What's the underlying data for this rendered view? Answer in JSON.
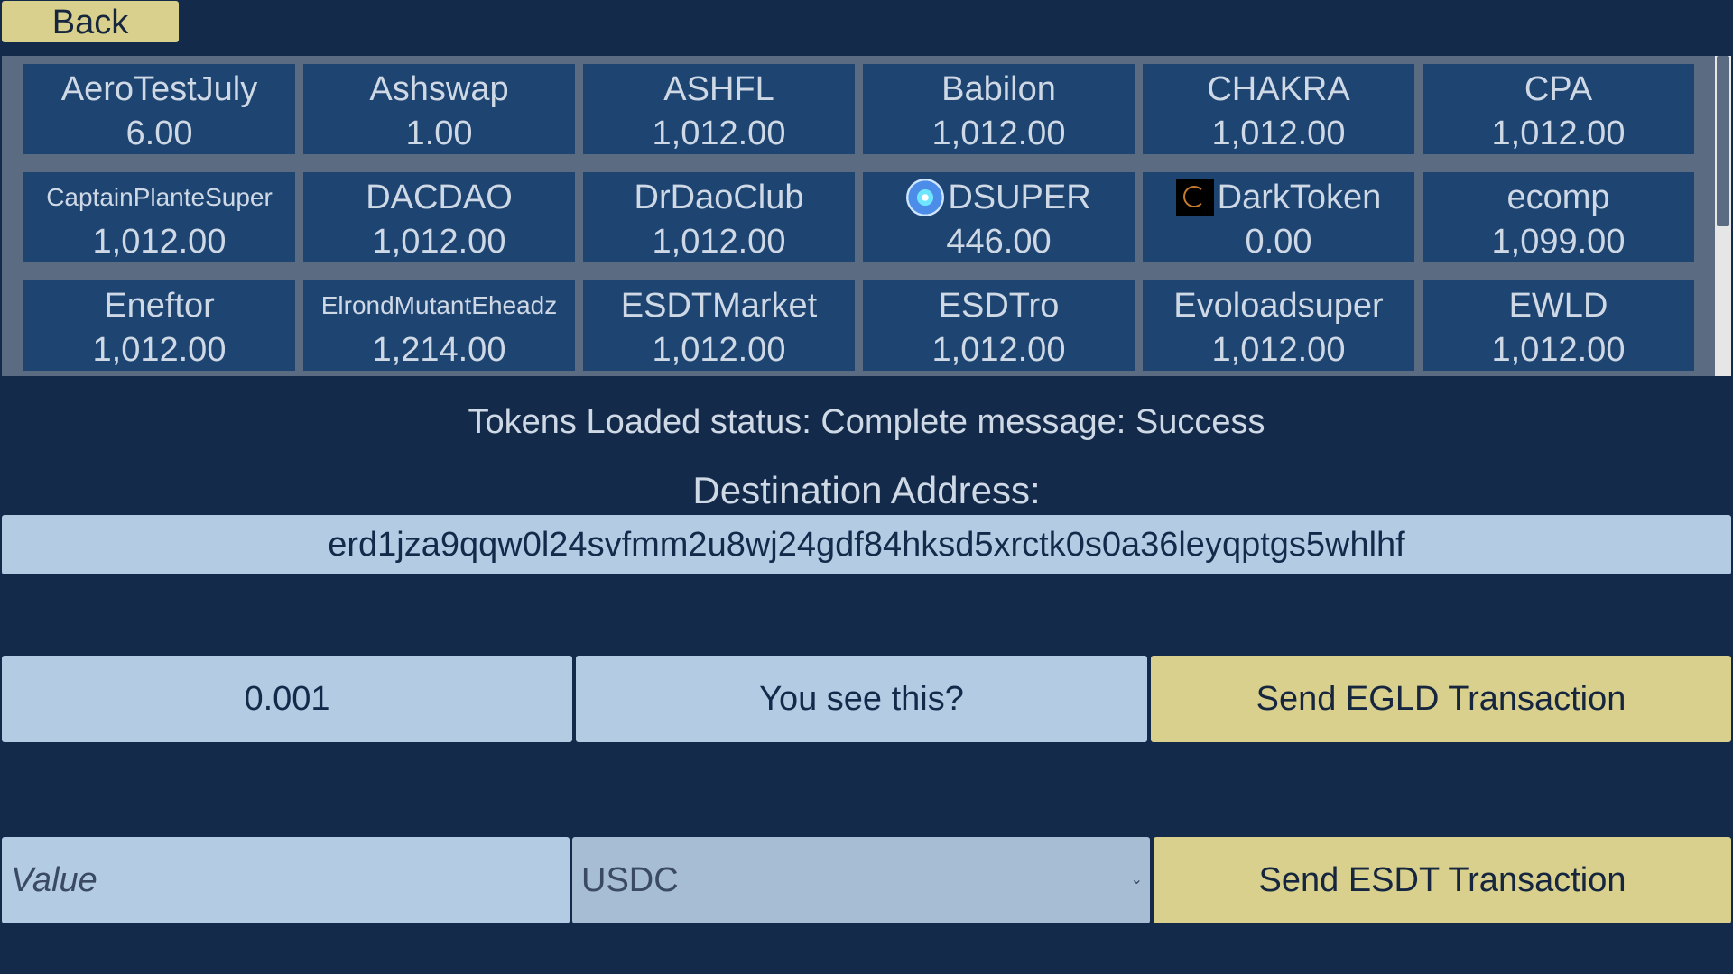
{
  "back_label": "Back",
  "tokens": [
    {
      "name": "AeroTestJuly",
      "value": "6.00"
    },
    {
      "name": "Ashswap",
      "value": "1.00"
    },
    {
      "name": "ASHFL",
      "value": "1,012.00"
    },
    {
      "name": "Babilon",
      "value": "1,012.00"
    },
    {
      "name": "CHAKRA",
      "value": "1,012.00"
    },
    {
      "name": "CPA",
      "value": "1,012.00"
    },
    {
      "name": "CaptainPlanteSuper",
      "value": "1,012.00"
    },
    {
      "name": "DACDAO",
      "value": "1,012.00"
    },
    {
      "name": "DrDaoClub",
      "value": "1,012.00"
    },
    {
      "name": "DSUPER",
      "value": "446.00",
      "icon": "dsuper-logo-icon"
    },
    {
      "name": "DarkToken",
      "value": "0.00",
      "icon": "darktoken-logo-icon"
    },
    {
      "name": "ecomp",
      "value": "1,099.00"
    },
    {
      "name": "Eneftor",
      "value": "1,012.00"
    },
    {
      "name": "ElrondMutantEheadz",
      "value": "1,214.00"
    },
    {
      "name": "ESDTMarket",
      "value": "1,012.00"
    },
    {
      "name": "ESDTro",
      "value": "1,012.00"
    },
    {
      "name": "Evoloadsuper",
      "value": "1,012.00"
    },
    {
      "name": "EWLD",
      "value": "1,012.00"
    }
  ],
  "status_text": "Tokens Loaded status: Complete message: Success",
  "destination_label": "Destination Address:",
  "destination_address": "erd1jza9qqw0l24svfmm2u8wj24gdf84hksd5xrctk0s0a36leyqptgs5whlhf",
  "egld_amount": "0.001",
  "egld_message": "You see this?",
  "send_egld_label": "Send EGLD Transaction",
  "esdt_value_placeholder": "Value",
  "esdt_selected_token": "USDC",
  "send_esdt_label": "Send ESDT Transaction",
  "colors": {
    "background": "#132a4a",
    "tile": "#1e4472",
    "button_gold": "#d8d08c",
    "input_light": "#b3cce3"
  }
}
